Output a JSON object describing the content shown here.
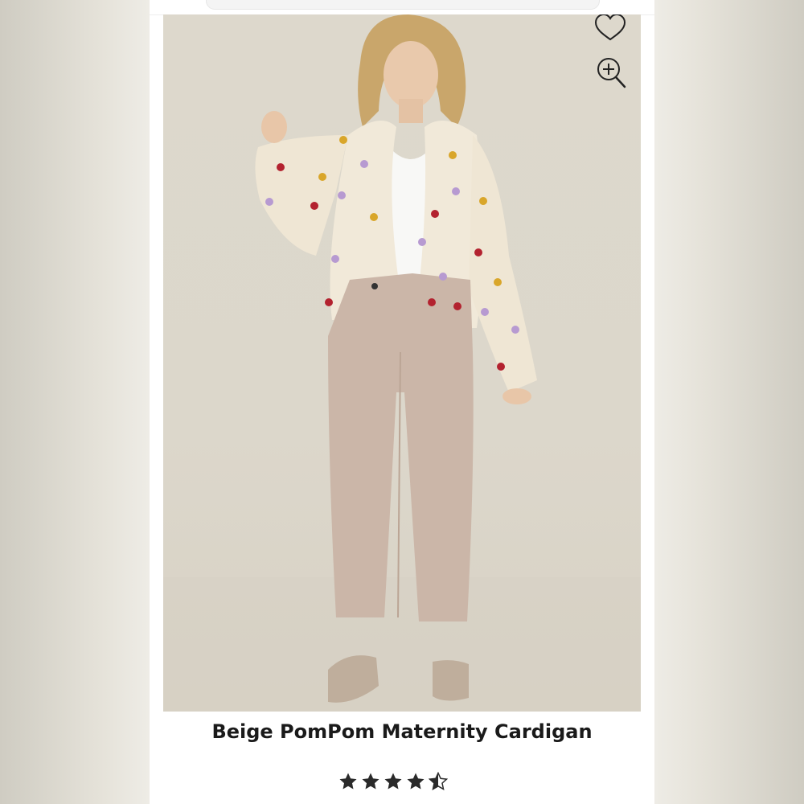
{
  "product": {
    "title": "Beige PomPom Maternity Cardigan",
    "rating": 4.5,
    "rating_max": 5
  },
  "actions": {
    "favorite_icon": "heart-outline-icon",
    "zoom_icon": "zoom-in-icon"
  },
  "colors": {
    "background": "#e6e3da",
    "card": "#ffffff",
    "text": "#1a1a1a",
    "star": "#2a2a2a",
    "cardigan": "#f1e9d9",
    "pants": "#cbb6a8",
    "pompom_red": "#b3222f",
    "pompom_yellow": "#d9a62a",
    "pompom_purple": "#b79ad1"
  }
}
